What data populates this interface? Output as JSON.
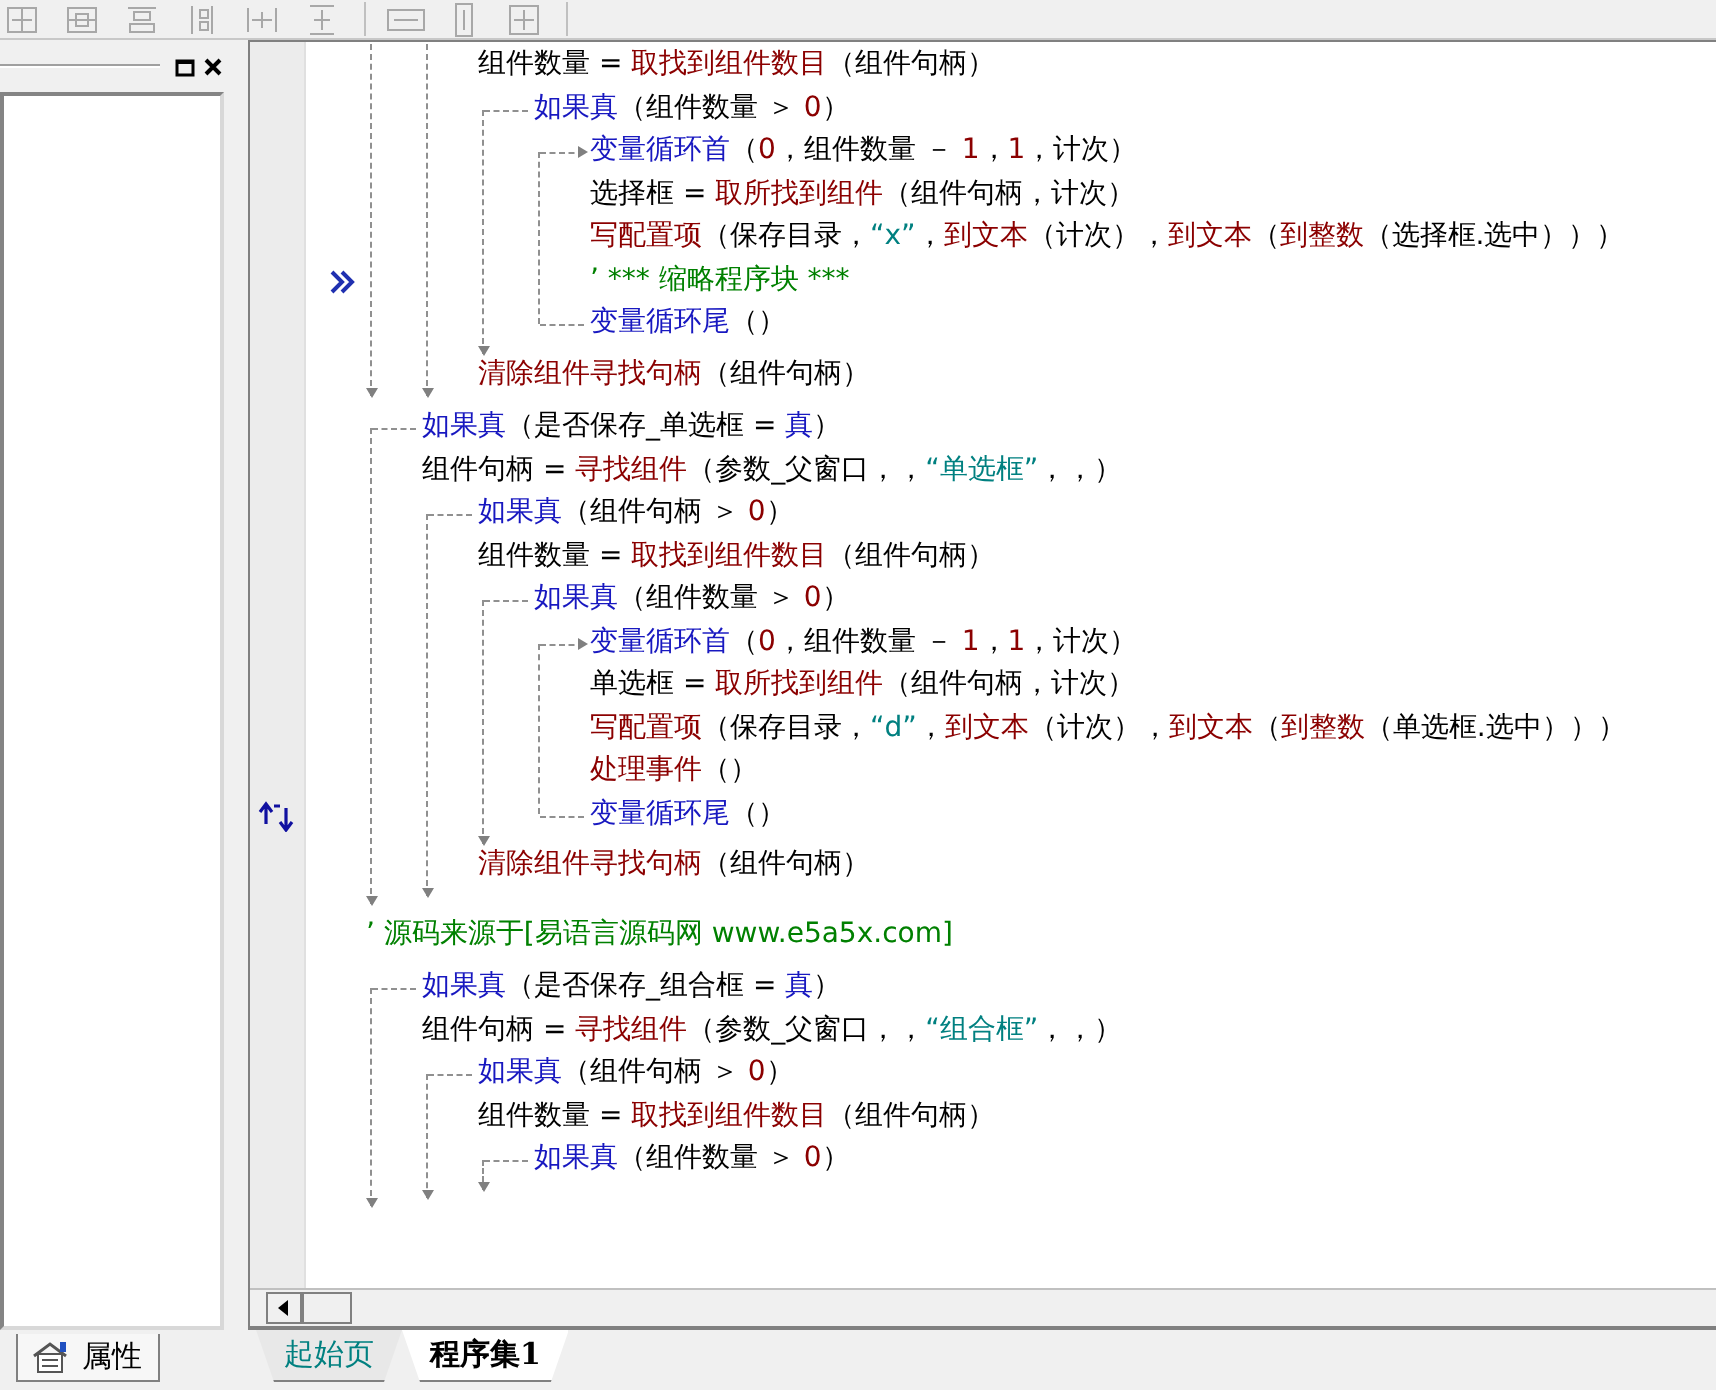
{
  "side_panel": {
    "tabs": [
      {
        "label": "属性",
        "selected": true
      }
    ]
  },
  "editor": {
    "code": [
      {
        "kind": "group",
        "children": [
          {
            "kind": "group",
            "children": [
              {
                "kind": "line",
                "tokens": [
                  {
                    "kind": "plain",
                    "text": "组件数量 = "
                  },
                  {
                    "kind": "func",
                    "text": "取找到组件数目"
                  },
                  {
                    "kind": "plain",
                    "text": "（组件句柄）"
                  }
                ]
              },
              {
                "kind": "if",
                "tokens": [
                  {
                    "kind": "keyword",
                    "text": "如果真"
                  },
                  {
                    "kind": "plain",
                    "text": "（组件数量 ＞ "
                  },
                  {
                    "kind": "number",
                    "text": "0"
                  },
                  {
                    "kind": "plain",
                    "text": "）"
                  }
                ],
                "children": [
                  {
                    "kind": "loop",
                    "tokens": [
                      {
                        "kind": "keyword",
                        "text": "变量循环首"
                      },
                      {
                        "kind": "plain",
                        "text": "（"
                      },
                      {
                        "kind": "number",
                        "text": "0"
                      },
                      {
                        "kind": "plain",
                        "text": "，组件数量 － "
                      },
                      {
                        "kind": "number",
                        "text": "1"
                      },
                      {
                        "kind": "plain",
                        "text": "，"
                      },
                      {
                        "kind": "number",
                        "text": "1"
                      },
                      {
                        "kind": "plain",
                        "text": "，计次）"
                      }
                    ],
                    "children": [
                      {
                        "kind": "line",
                        "tokens": [
                          {
                            "kind": "plain",
                            "text": "选择框 = "
                          },
                          {
                            "kind": "func",
                            "text": "取所找到组件"
                          },
                          {
                            "kind": "plain",
                            "text": "（组件句柄，计次）"
                          }
                        ]
                      },
                      {
                        "kind": "line",
                        "tokens": [
                          {
                            "kind": "func",
                            "text": "写配置项"
                          },
                          {
                            "kind": "plain",
                            "text": "（保存目录，"
                          },
                          {
                            "kind": "string",
                            "text": "“x”"
                          },
                          {
                            "kind": "plain",
                            "text": "，"
                          },
                          {
                            "kind": "func",
                            "text": "到文本"
                          },
                          {
                            "kind": "plain",
                            "text": "（计次），"
                          },
                          {
                            "kind": "func",
                            "text": "到文本"
                          },
                          {
                            "kind": "plain",
                            "text": "（"
                          },
                          {
                            "kind": "func",
                            "text": "到整数"
                          },
                          {
                            "kind": "plain",
                            "text": "（选择框.选中）））"
                          }
                        ]
                      },
                      {
                        "kind": "line",
                        "collapsed": true,
                        "tokens": [
                          {
                            "kind": "comment",
                            "text": "’ *** 缩略程序块 ***"
                          }
                        ]
                      }
                    ],
                    "tail": [
                      {
                        "kind": "keyword",
                        "text": "变量循环尾"
                      },
                      {
                        "kind": "plain",
                        "text": "（）"
                      }
                    ]
                  }
                ]
              },
              {
                "kind": "line",
                "tokens": [
                  {
                    "kind": "func",
                    "text": "清除组件寻找句柄"
                  },
                  {
                    "kind": "plain",
                    "text": "（组件句柄）"
                  }
                ]
              }
            ]
          }
        ]
      },
      {
        "kind": "if",
        "tokens": [
          {
            "kind": "keyword",
            "text": "如果真"
          },
          {
            "kind": "plain",
            "text": "（是否保存_单选框 = "
          },
          {
            "kind": "keyword",
            "text": "真"
          },
          {
            "kind": "plain",
            "text": "）"
          }
        ],
        "children": [
          {
            "kind": "line",
            "tokens": [
              {
                "kind": "plain",
                "text": "组件句柄 = "
              },
              {
                "kind": "func",
                "text": "寻找组件"
              },
              {
                "kind": "plain",
                "text": "（参数_父窗口，，"
              },
              {
                "kind": "string",
                "text": "“单选框”"
              },
              {
                "kind": "plain",
                "text": "，，）"
              }
            ]
          },
          {
            "kind": "if",
            "tokens": [
              {
                "kind": "keyword",
                "text": "如果真"
              },
              {
                "kind": "plain",
                "text": "（组件句柄 ＞ "
              },
              {
                "kind": "number",
                "text": "0"
              },
              {
                "kind": "plain",
                "text": "）"
              }
            ],
            "children": [
              {
                "kind": "line",
                "tokens": [
                  {
                    "kind": "plain",
                    "text": "组件数量 = "
                  },
                  {
                    "kind": "func",
                    "text": "取找到组件数目"
                  },
                  {
                    "kind": "plain",
                    "text": "（组件句柄）"
                  }
                ]
              },
              {
                "kind": "if",
                "tokens": [
                  {
                    "kind": "keyword",
                    "text": "如果真"
                  },
                  {
                    "kind": "plain",
                    "text": "（组件数量 ＞ "
                  },
                  {
                    "kind": "number",
                    "text": "0"
                  },
                  {
                    "kind": "plain",
                    "text": "）"
                  }
                ],
                "children": [
                  {
                    "kind": "loop",
                    "tokens": [
                      {
                        "kind": "keyword",
                        "text": "变量循环首"
                      },
                      {
                        "kind": "plain",
                        "text": "（"
                      },
                      {
                        "kind": "number",
                        "text": "0"
                      },
                      {
                        "kind": "plain",
                        "text": "，组件数量 － "
                      },
                      {
                        "kind": "number",
                        "text": "1"
                      },
                      {
                        "kind": "plain",
                        "text": "，"
                      },
                      {
                        "kind": "number",
                        "text": "1"
                      },
                      {
                        "kind": "plain",
                        "text": "，计次）"
                      }
                    ],
                    "children": [
                      {
                        "kind": "line",
                        "tokens": [
                          {
                            "kind": "plain",
                            "text": "单选框 = "
                          },
                          {
                            "kind": "func",
                            "text": "取所找到组件"
                          },
                          {
                            "kind": "plain",
                            "text": "（组件句柄，计次）"
                          }
                        ]
                      },
                      {
                        "kind": "line",
                        "tokens": [
                          {
                            "kind": "func",
                            "text": "写配置项"
                          },
                          {
                            "kind": "plain",
                            "text": "（保存目录，"
                          },
                          {
                            "kind": "string",
                            "text": "“d”"
                          },
                          {
                            "kind": "plain",
                            "text": "，"
                          },
                          {
                            "kind": "func",
                            "text": "到文本"
                          },
                          {
                            "kind": "plain",
                            "text": "（计次），"
                          },
                          {
                            "kind": "func",
                            "text": "到文本"
                          },
                          {
                            "kind": "plain",
                            "text": "（"
                          },
                          {
                            "kind": "func",
                            "text": "到整数"
                          },
                          {
                            "kind": "plain",
                            "text": "（单选框.选中）））"
                          }
                        ]
                      },
                      {
                        "kind": "line",
                        "tokens": [
                          {
                            "kind": "func",
                            "text": "处理事件"
                          },
                          {
                            "kind": "plain",
                            "text": "（）"
                          }
                        ]
                      }
                    ],
                    "tail_current": true,
                    "tail": [
                      {
                        "kind": "keyword",
                        "text": "变量循环尾"
                      },
                      {
                        "kind": "plain",
                        "text": "（）"
                      }
                    ]
                  }
                ]
              },
              {
                "kind": "line",
                "tokens": [
                  {
                    "kind": "func",
                    "text": "清除组件寻找句柄"
                  },
                  {
                    "kind": "plain",
                    "text": "（组件句柄）"
                  }
                ]
              }
            ]
          }
        ]
      },
      {
        "kind": "line",
        "tokens": [
          {
            "kind": "comment",
            "text": "’ 源码来源于[易语言源码网 www.e5a5x.com]"
          }
        ]
      },
      {
        "kind": "if",
        "tokens": [
          {
            "kind": "keyword",
            "text": "如果真"
          },
          {
            "kind": "plain",
            "text": "（是否保存_组合框 = "
          },
          {
            "kind": "keyword",
            "text": "真"
          },
          {
            "kind": "plain",
            "text": "）"
          }
        ],
        "children": [
          {
            "kind": "line",
            "tokens": [
              {
                "kind": "plain",
                "text": "组件句柄 = "
              },
              {
                "kind": "func",
                "text": "寻找组件"
              },
              {
                "kind": "plain",
                "text": "（参数_父窗口，，"
              },
              {
                "kind": "string",
                "text": "“组合框”"
              },
              {
                "kind": "plain",
                "text": "，，）"
              }
            ]
          },
          {
            "kind": "if",
            "tokens": [
              {
                "kind": "keyword",
                "text": "如果真"
              },
              {
                "kind": "plain",
                "text": "（组件句柄 ＞ "
              },
              {
                "kind": "number",
                "text": "0"
              },
              {
                "kind": "plain",
                "text": "）"
              }
            ],
            "children": [
              {
                "kind": "line",
                "tokens": [
                  {
                    "kind": "plain",
                    "text": "组件数量 = "
                  },
                  {
                    "kind": "func",
                    "text": "取找到组件数目"
                  },
                  {
                    "kind": "plain",
                    "text": "（组件句柄）"
                  }
                ]
              },
              {
                "kind": "if",
                "tokens": [
                  {
                    "kind": "keyword",
                    "text": "如果真"
                  },
                  {
                    "kind": "plain",
                    "text": "（组件数量 ＞ "
                  },
                  {
                    "kind": "number",
                    "text": "0"
                  },
                  {
                    "kind": "plain",
                    "text": "）"
                  }
                ]
              }
            ]
          }
        ]
      }
    ]
  },
  "doc_tabs": [
    {
      "label": "起始页",
      "selected": false
    },
    {
      "label": "程序集1",
      "selected": true
    }
  ]
}
